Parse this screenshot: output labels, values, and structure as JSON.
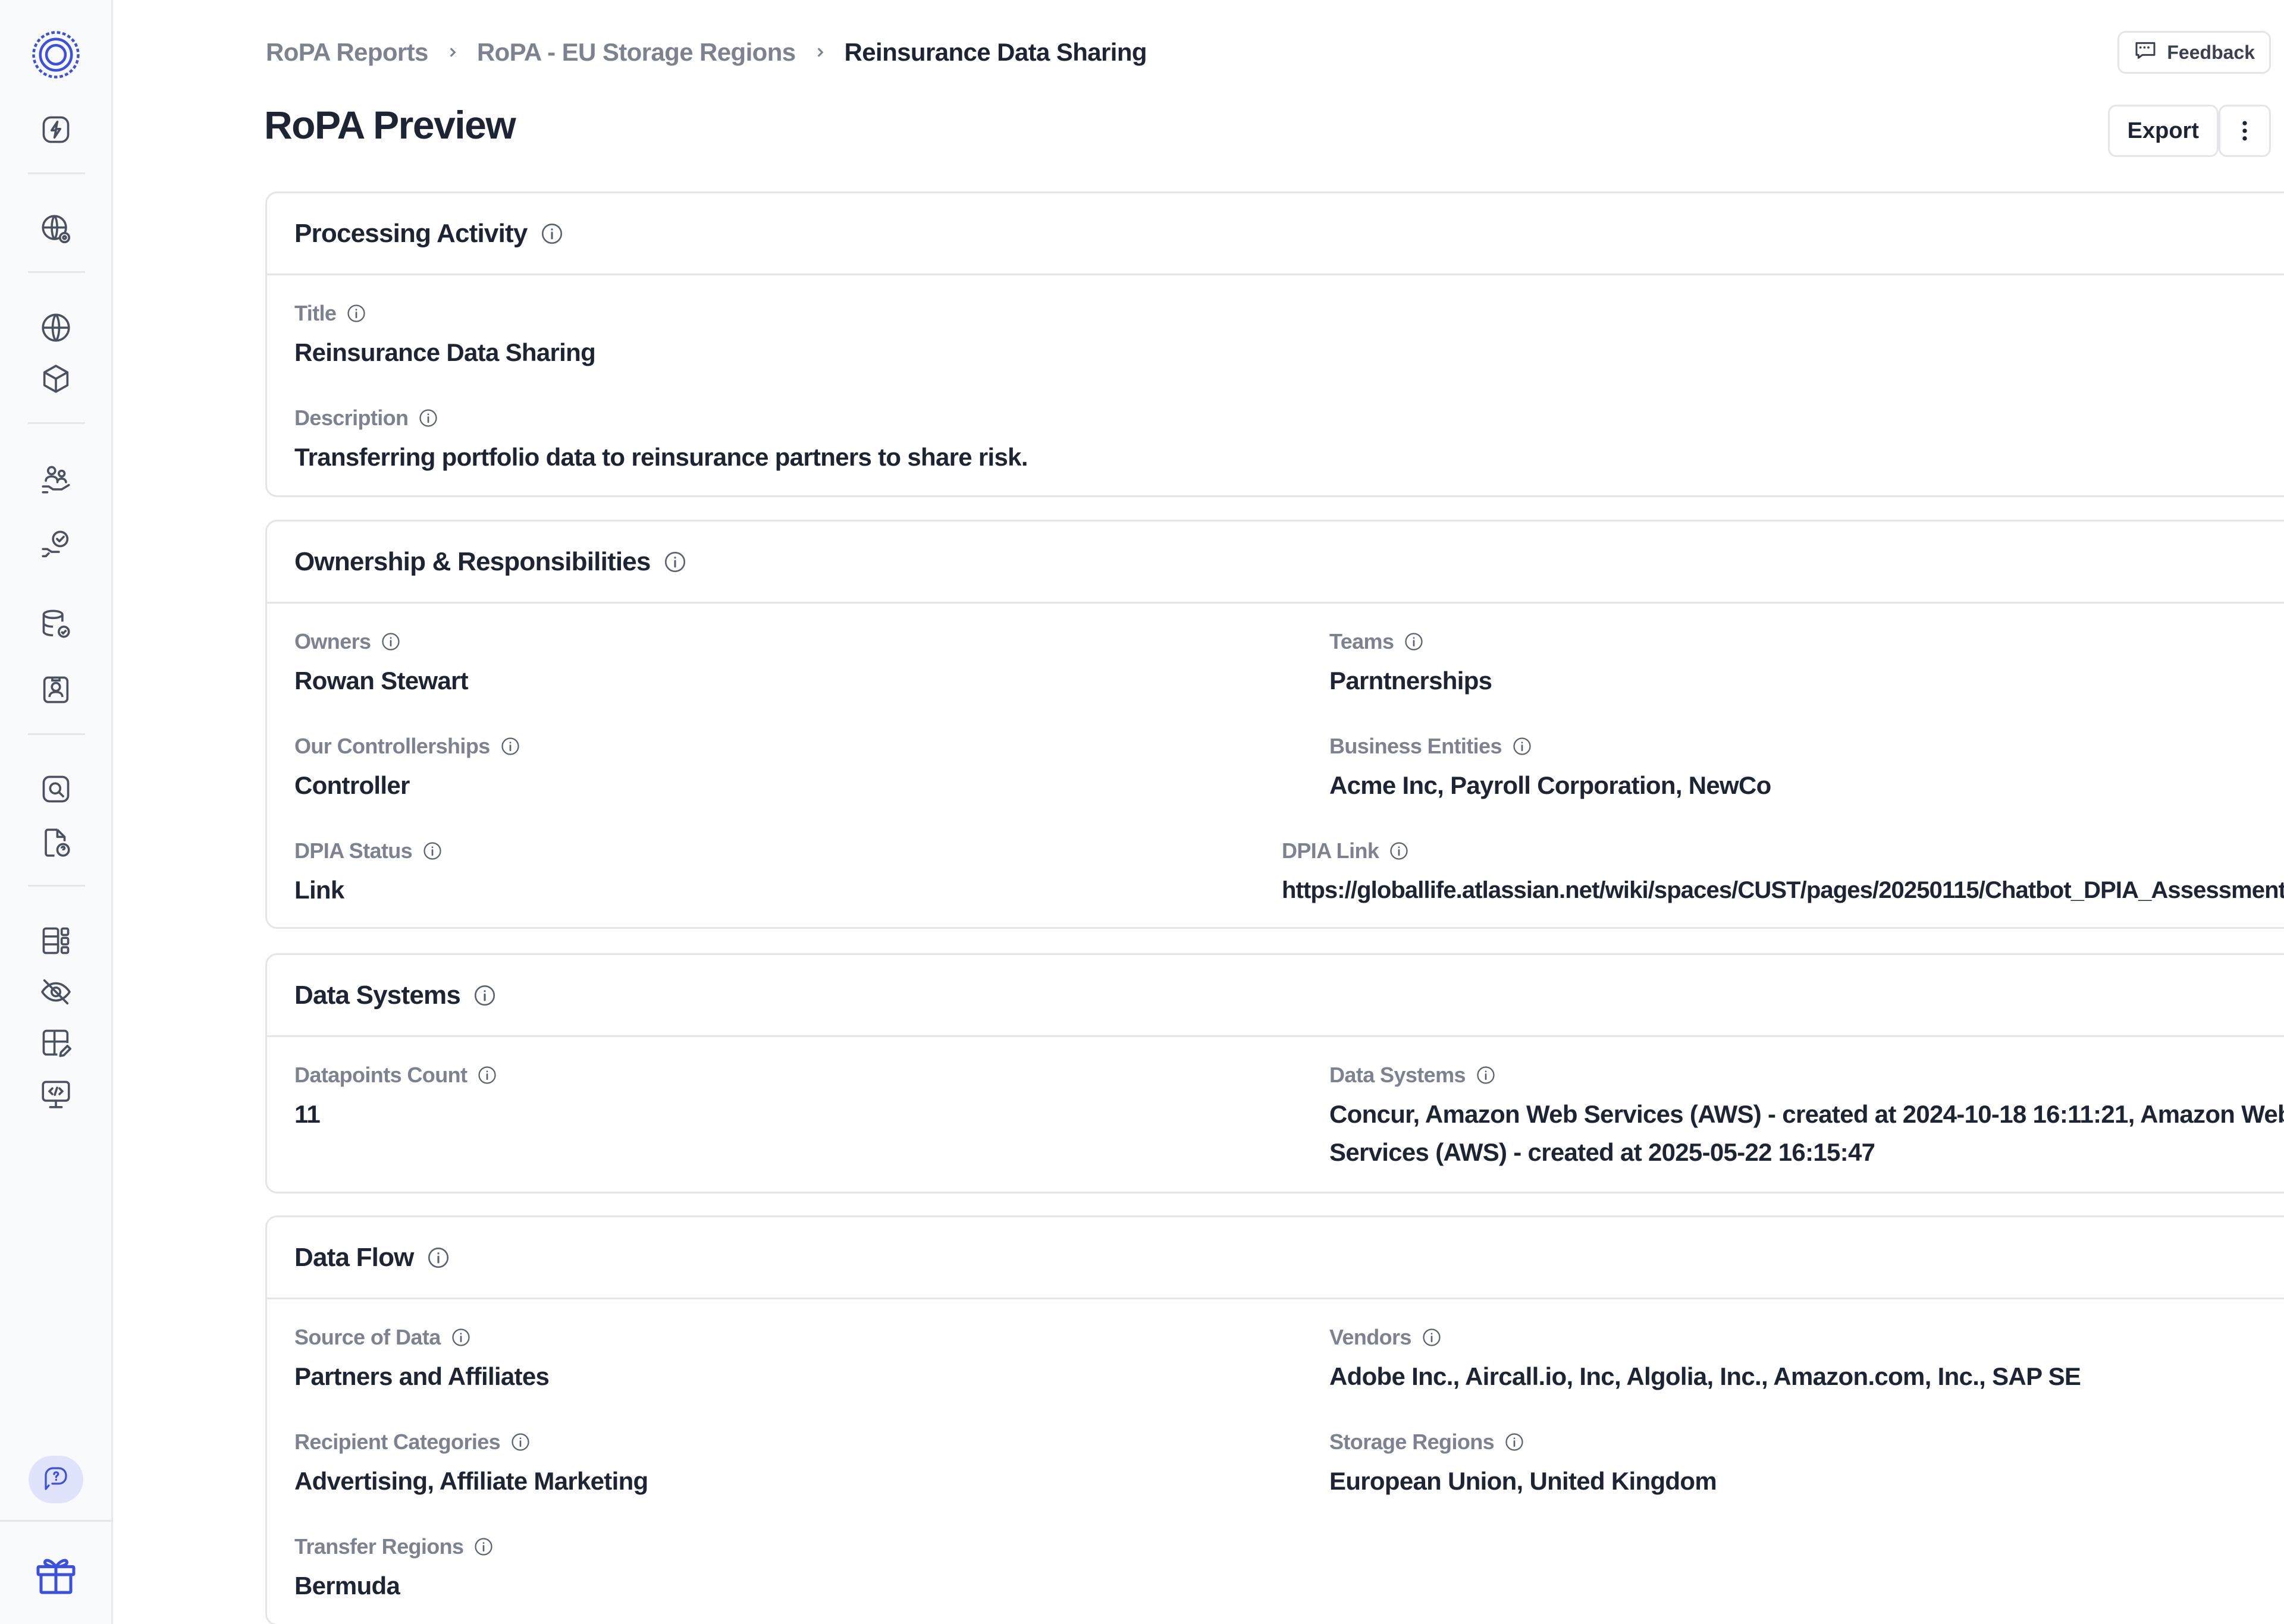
{
  "breadcrumb": {
    "items": [
      "RoPA Reports",
      "RoPA - EU Storage Regions",
      "Reinsurance Data Sharing"
    ]
  },
  "header": {
    "feedback_label": "Feedback",
    "title": "RoPA Preview",
    "export_label": "Export"
  },
  "sections": {
    "processing_activity": {
      "title": "Processing Activity",
      "title_label": "Title",
      "title_value": "Reinsurance Data Sharing",
      "description_label": "Description",
      "description_value": "Transferring portfolio data to reinsurance partners to share risk."
    },
    "ownership": {
      "title": "Ownership & Responsibilities",
      "owners_label": "Owners",
      "owners_value": "Rowan Stewart",
      "teams_label": "Teams",
      "teams_value": "Parntnerships",
      "controllerships_label": "Our Controllerships",
      "controllerships_value": "Controller",
      "business_entities_label": "Business Entities",
      "business_entities_value": "Acme Inc, Payroll Corporation, NewCo",
      "dpia_status_label": "DPIA Status",
      "dpia_status_value": "Link",
      "dpia_link_label": "DPIA Link",
      "dpia_link_value": "https://globallife.atlassian.net/wiki/spaces/CUST/pages/20250115/Chatbot_DPIA_Assessment"
    },
    "data_systems": {
      "title": "Data Systems",
      "datapoints_label": "Datapoints Count",
      "datapoints_value": "11",
      "systems_label": "Data Systems",
      "systems_value": "Concur, Amazon Web Services (AWS) - created at 2024-10-18 16:11:21, Amazon Web Services (AWS) - created at 2025-05-22 16:15:47"
    },
    "data_flow": {
      "title": "Data Flow",
      "source_label": "Source of Data",
      "source_value": "Partners and Affiliates",
      "vendors_label": "Vendors",
      "vendors_value": "Adobe Inc., Aircall.io, Inc, Algolia, Inc., Amazon.com, Inc., SAP SE",
      "recipient_label": "Recipient Categories",
      "recipient_value": "Advertising, Affiliate Marketing",
      "storage_label": "Storage Regions",
      "storage_value": "European Union, United Kingdom",
      "transfer_label": "Transfer Regions",
      "transfer_value": "Bermuda"
    }
  },
  "sidebar": {
    "icons": [
      "logo-icon",
      "lightning-icon",
      "globe-settings-icon",
      "globe-icon",
      "cube-icon",
      "people-hand-icon",
      "hand-check-icon",
      "database-check-icon",
      "person-card-icon",
      "search-box-icon",
      "file-question-icon",
      "grid-layout-icon",
      "eye-off-icon",
      "table-edit-icon",
      "code-monitor-icon",
      "help-chat-icon",
      "gift-icon"
    ]
  },
  "colors": {
    "accent": "#3b4fe0",
    "text_primary": "#1d2433",
    "text_muted": "#7c8290",
    "border": "#e3e5e9",
    "help_bg": "#dfe3fb"
  }
}
